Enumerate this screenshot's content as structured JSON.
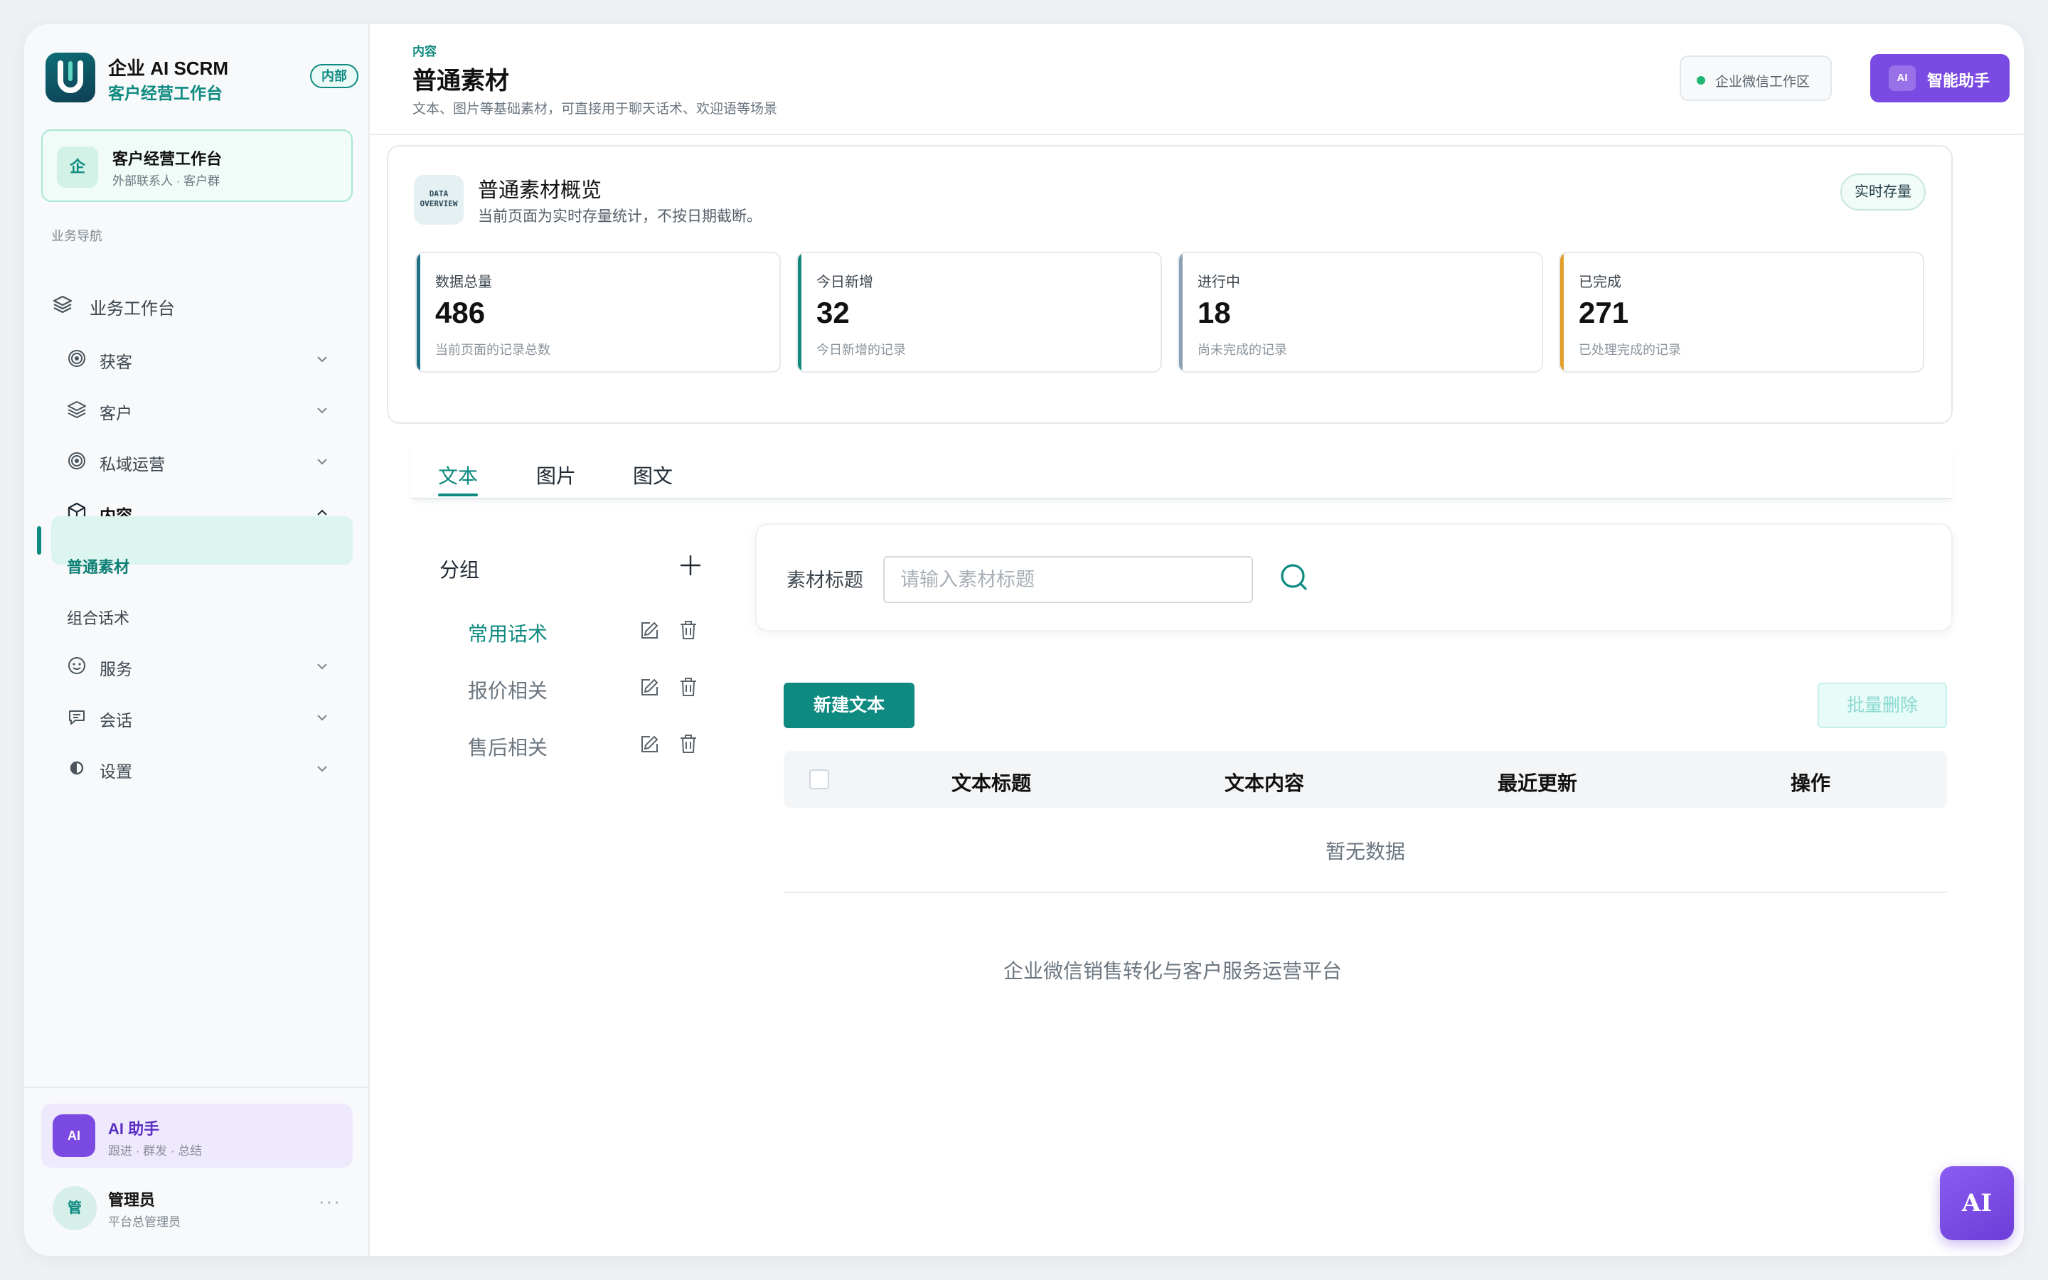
{
  "brand": {
    "title": "企业 AI SCRM",
    "subtitle": "客户经营工作台",
    "badge": "内部"
  },
  "workspace_card": {
    "icon_text": "企",
    "title": "客户经营工作台",
    "subtitle": "外部联系人 · 客户群"
  },
  "sidebar": {
    "section_label": "业务导航",
    "top_item": {
      "label": "业务工作台",
      "icon": "layers-icon"
    },
    "items": [
      {
        "label": "获客",
        "icon": "target-icon",
        "expanded": false
      },
      {
        "label": "客户",
        "icon": "layers-icon",
        "expanded": false
      },
      {
        "label": "私域运营",
        "icon": "target-icon",
        "expanded": false
      },
      {
        "label": "内容",
        "icon": "cube-icon",
        "expanded": true
      },
      {
        "label": "服务",
        "icon": "smile-icon",
        "expanded": false
      },
      {
        "label": "会话",
        "icon": "chat-icon",
        "expanded": false
      },
      {
        "label": "设置",
        "icon": "settings-icon",
        "expanded": false
      }
    ],
    "content_children": [
      {
        "label": "普通素材",
        "active": true
      },
      {
        "label": "组合话术",
        "active": false
      }
    ],
    "ai_card": {
      "avatar": "AI",
      "title": "AI 助手",
      "subtitle": "跟进 · 群发 · 总结"
    },
    "user": {
      "avatar": "管",
      "name": "管理员",
      "role": "平台总管理员",
      "more": "···"
    }
  },
  "header": {
    "breadcrumb": "内容",
    "title": "普通素材",
    "description": "文本、图片等基础素材，可直接用于聊天话术、欢迎语等场景",
    "workspace_pill": "企业微信工作区",
    "ai_button": {
      "badge": "AI",
      "label": "智能助手"
    }
  },
  "overview": {
    "icon_text": "DATA OVERVIEW",
    "title": "普通素材概览",
    "subtitle": "当前页面为实时存量统计，不按日期截断。",
    "tag": "实时存量",
    "stats": [
      {
        "label": "数据总量",
        "value": "486",
        "note": "当前页面的记录总数",
        "accent": "#1f6f86"
      },
      {
        "label": "今日新增",
        "value": "32",
        "note": "今日新增的记录",
        "accent": "#11897c"
      },
      {
        "label": "进行中",
        "value": "18",
        "note": "尚未完成的记录",
        "accent": "#8aa0b4"
      },
      {
        "label": "已完成",
        "value": "271",
        "note": "已处理完成的记录",
        "accent": "#e0a02a"
      }
    ]
  },
  "tabs": [
    {
      "label": "文本",
      "active": true
    },
    {
      "label": "图片",
      "active": false
    },
    {
      "label": "图文",
      "active": false
    }
  ],
  "groups": {
    "title": "分组",
    "items": [
      {
        "name": "常用话术",
        "active": true
      },
      {
        "name": "报价相关",
        "active": false
      },
      {
        "name": "售后相关",
        "active": false
      }
    ]
  },
  "search": {
    "label": "素材标题",
    "placeholder": "请输入素材标题",
    "value": ""
  },
  "table": {
    "new_button": "新建文本",
    "batch_delete_button": "批量删除",
    "columns": [
      "文本标题",
      "文本内容",
      "最近更新",
      "操作"
    ],
    "empty_text": "暂无数据"
  },
  "footer": "企业微信销售转化与客户服务运营平台",
  "fab": "AI",
  "colors": {
    "primary": "#0e8a80",
    "ai_purple": "#7b4ae2",
    "status_online": "#22b573"
  }
}
